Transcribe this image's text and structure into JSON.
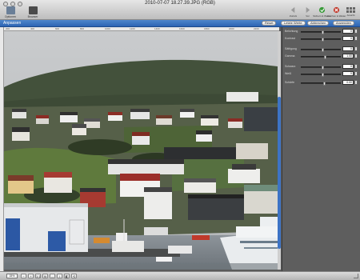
{
  "window": {
    "title": "2010-07-07 18.27.39.JPG (RGB)"
  },
  "toolbar": {
    "left_items": [
      {
        "label": "Optionen",
        "icon": "options-icon"
      },
      {
        "label": "Browser",
        "icon": "browser-icon"
      }
    ],
    "right_items": [
      {
        "label": "Zurück",
        "icon": "back-arrow-icon",
        "color": "#9a9a9a"
      },
      {
        "label": "Vor",
        "icon": "forward-arrow-icon",
        "color": "#9a9a9a"
      },
      {
        "label": "Sichern & Weiter",
        "icon": "save-continue-icon",
        "color": "#3a9a3a"
      },
      {
        "label": "Löschen & Weiter",
        "icon": "delete-continue-icon",
        "color": "#c0392b"
      },
      {
        "label": "Ansicht",
        "icon": "view-grid-icon",
        "color": "#666666"
      }
    ]
  },
  "panel": {
    "title": "Anpassen",
    "buttons": {
      "reset": "Reset",
      "last_values": "Letzte Werte",
      "cancel": "Abbrechen",
      "apply": "Anwenden"
    },
    "sliders": [
      {
        "label": "Belichtung",
        "value": "0",
        "level": 0.55
      },
      {
        "label": "Kontrast",
        "value": "0",
        "level": 0.55
      },
      {
        "label": "Sättigung",
        "value": "0",
        "level": 0.55
      },
      {
        "label": "Gamma",
        "value": "1.00",
        "level": 0.62
      },
      {
        "label": "Schwarz",
        "value": "0",
        "level": 0.55
      },
      {
        "label": "Weiß",
        "value": "0",
        "level": 0.55
      },
      {
        "label": "Schärfe",
        "value": "0.00",
        "level": 0.6
      }
    ]
  },
  "ruler": {
    "ticks": [
      "200",
      "400",
      "600",
      "800",
      "1000",
      "1200",
      "1400",
      "1600",
      "1800",
      "2000",
      "2200"
    ]
  },
  "statusbar": {
    "zoom": "15%",
    "buttons": [
      "−",
      "+",
      "1:1",
      "fit",
      "↔",
      "↕",
      "◧",
      "⟲"
    ]
  },
  "colors": {
    "accent": "#2d64b3",
    "panel_bg": "#5e5e5e"
  }
}
